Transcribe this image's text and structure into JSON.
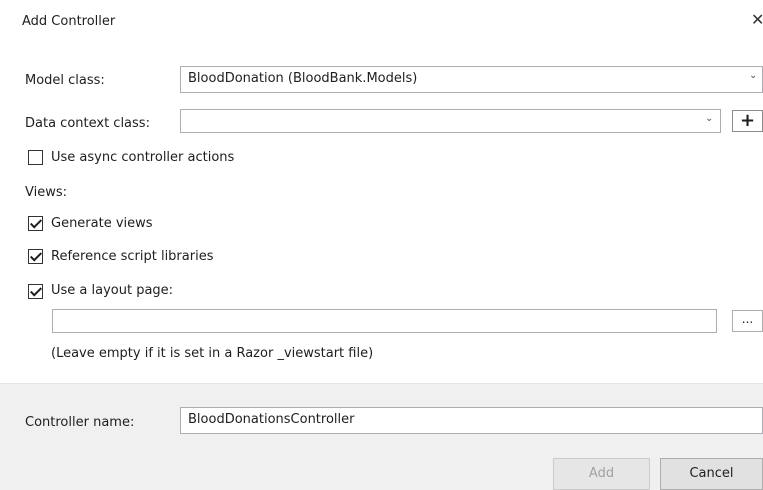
{
  "dialog": {
    "title": "Add Controller",
    "close_glyph": "✕"
  },
  "form": {
    "model_class": {
      "label": "Model class:",
      "value": "BloodDonation (BloodBank.Models)"
    },
    "data_context": {
      "label": "Data context class:",
      "value": "",
      "add_glyph": "+"
    },
    "async_actions": {
      "label": "Use async controller actions",
      "checked": false
    },
    "views": {
      "heading": "Views:",
      "generate_views": {
        "label": "Generate views",
        "checked": true
      },
      "reference_scripts": {
        "label": "Reference script libraries",
        "checked": true
      },
      "use_layout": {
        "label": "Use a layout page:",
        "checked": true
      },
      "layout_path": "",
      "browse_label": "...",
      "hint": "(Leave empty if it is set in a Razor _viewstart file)"
    }
  },
  "footer": {
    "controller_name_label": "Controller name:",
    "controller_name_value": "BloodDonationsController",
    "add_label": "Add",
    "cancel_label": "Cancel"
  },
  "icons": {
    "chevron": "chevron-down-icon",
    "check": "checkmark-icon"
  },
  "colors": {
    "footer_bg": "#f0f0f0",
    "disabled_text": "#a0a0a0",
    "border": "#abadb3"
  }
}
